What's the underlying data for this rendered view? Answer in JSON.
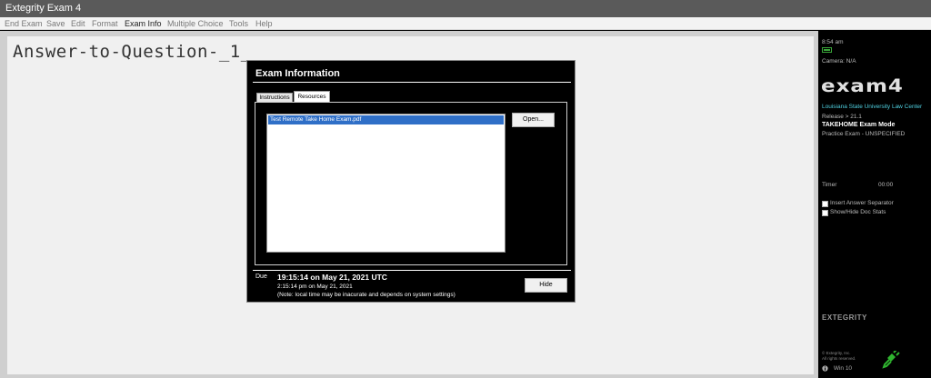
{
  "window": {
    "title": "Extegrity Exam 4"
  },
  "menu": [
    "End Exam",
    "Save",
    "Edit",
    "Format",
    "Exam Info",
    "Multiple Choice",
    "Tools",
    "Help"
  ],
  "editor": {
    "heading": "Answer-to-Question-_1_"
  },
  "dialog": {
    "title": "Exam Information",
    "tabs": [
      "Instructions",
      "Resources"
    ],
    "active_tab": "Resources",
    "resources": [
      "Test Remote Take Home Exam.pdf"
    ],
    "open_label": "Open...",
    "hide_label": "Hide",
    "due": {
      "label": "Due",
      "utc": "19:15:14 on May 21, 2021 UTC",
      "local": "2:15:14 pm on May 21, 2021",
      "note": "(Note: local time may be inacurate and depends on system settings)"
    }
  },
  "sidebar": {
    "time": "8:54 am",
    "camera": "Camera: N/A",
    "logo": "exam4",
    "institution": "Louisiana State University Law Center",
    "release": "Release > 21.1",
    "mode": "TAKEHOME Exam Mode",
    "exam_name": "Practice Exam - UNSPECIFIED",
    "timer_label": "Timer",
    "timer_value": "00:00",
    "checkboxes": [
      "Insert Answer Separator",
      "Show/Hide Doc Stats"
    ],
    "brand": "EXTEGRITY",
    "copyright_1": "© Extegrity, Inc.",
    "copyright_2": "All rights reserved.",
    "os": "Win 10",
    "colors": {
      "battery": "#3aa63a",
      "institution": "#4fd0e0",
      "power": "#2fb52f"
    }
  },
  "icons": [
    "battery-icon",
    "power-plug-icon",
    "info-circle-icon"
  ]
}
